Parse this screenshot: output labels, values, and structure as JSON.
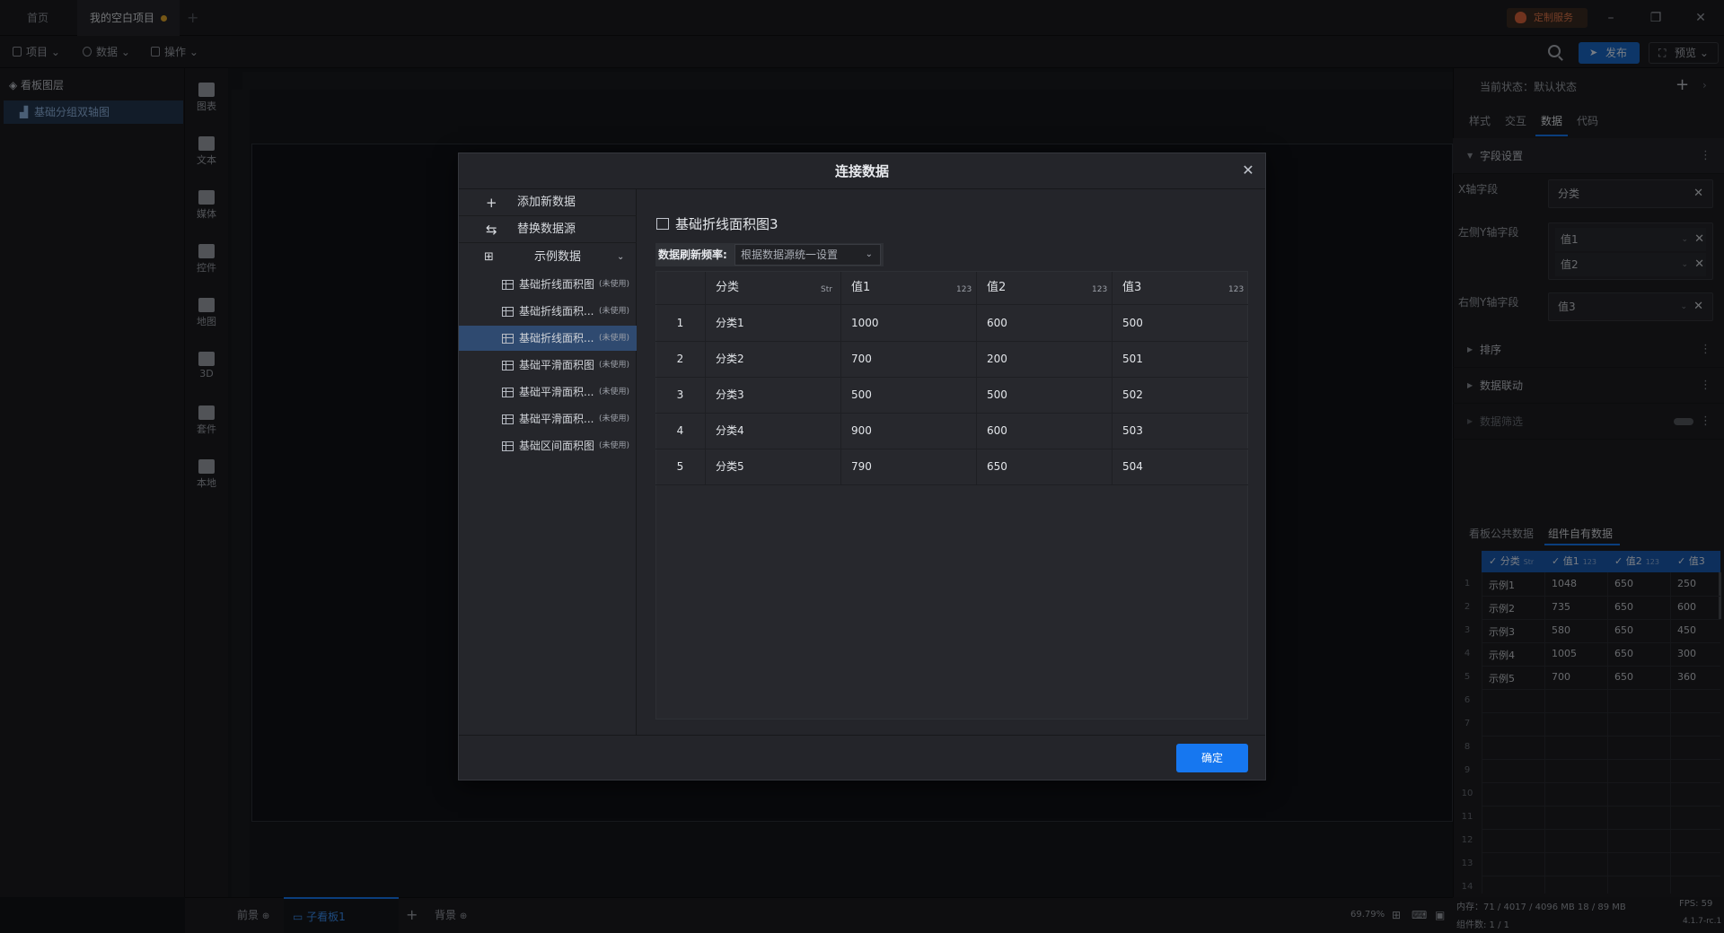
{
  "titlebar": {
    "tabs": [
      {
        "label": "首页"
      },
      {
        "label": "我的空白项目"
      }
    ],
    "custom_service": "定制服务"
  },
  "toolbar": {
    "menus": [
      {
        "label": "项目"
      },
      {
        "label": "数据"
      },
      {
        "label": "操作"
      }
    ],
    "publish": "发布",
    "preview": "预览"
  },
  "layers": {
    "header": "看板图层",
    "items": [
      {
        "label": "基础分组双轴图"
      }
    ]
  },
  "components": [
    {
      "label": "图表"
    },
    {
      "label": "文本"
    },
    {
      "label": "媒体"
    },
    {
      "label": "控件"
    },
    {
      "label": "地图"
    },
    {
      "label": "3D"
    },
    {
      "label": "套件"
    },
    {
      "label": "本地"
    }
  ],
  "right_panel": {
    "state_label": "当前状态：默认状态",
    "tabs": [
      {
        "label": "样式"
      },
      {
        "label": "交互"
      },
      {
        "label": "数据"
      },
      {
        "label": "代码"
      }
    ],
    "field_settings": "字段设置",
    "x_axis_label": "X轴字段",
    "x_axis_value": "分类",
    "left_y_label": "左侧Y轴字段",
    "left_y_values": [
      "值1",
      "值2"
    ],
    "right_y_label": "右侧Y轴字段",
    "right_y_value": "值3",
    "sections": [
      {
        "label": "排序"
      },
      {
        "label": "数据联动"
      },
      {
        "label": "数据筛选"
      }
    ],
    "data_tabs": [
      {
        "label": "看板公共数据"
      },
      {
        "label": "组件自有数据"
      }
    ],
    "table": {
      "columns": [
        "分类",
        "值1",
        "值2",
        "值3"
      ],
      "rows": [
        [
          "示例1",
          "1048",
          "650",
          "250"
        ],
        [
          "示例2",
          "735",
          "650",
          "600"
        ],
        [
          "示例3",
          "580",
          "650",
          "450"
        ],
        [
          "示例4",
          "1005",
          "650",
          "300"
        ],
        [
          "示例5",
          "700",
          "650",
          "360"
        ]
      ],
      "row_numbers": [
        "1",
        "2",
        "3",
        "4",
        "5",
        "6",
        "7",
        "8",
        "9",
        "10",
        "11",
        "12",
        "13",
        "14"
      ]
    }
  },
  "bottom": {
    "tabs": [
      {
        "label": "前景"
      },
      {
        "label": "子看板1"
      },
      {
        "label": "背景"
      }
    ],
    "zoom": "69.79%",
    "memory": "内存：71 / 4017 / 4096 MB  18 / 89 MB",
    "fps": "FPS: 59",
    "component_count": "组件数: 1 / 1",
    "version": "4.1.7-rc.1"
  },
  "modal": {
    "title": "连接数据",
    "add_data": "添加新数据",
    "replace_source": "替换数据源",
    "group": "示例数据",
    "sources": [
      {
        "label": "基础折线面积图",
        "tag": "(未使用)"
      },
      {
        "label": "基础折线面积...",
        "tag": "(未使用)"
      },
      {
        "label": "基础折线面积...",
        "tag": "(未使用)"
      },
      {
        "label": "基础平滑面积图",
        "tag": "(未使用)"
      },
      {
        "label": "基础平滑面积...",
        "tag": "(未使用)"
      },
      {
        "label": "基础平滑面积...",
        "tag": "(未使用)"
      },
      {
        "label": "基础区间面积图",
        "tag": "(未使用)"
      }
    ],
    "dataset_title": "基础折线面积图3",
    "refresh_label": "数据刷新频率:",
    "refresh_value": "根据数据源统一设置",
    "grid": {
      "columns": [
        {
          "label": "分类",
          "type": "Str"
        },
        {
          "label": "值1",
          "type": "123"
        },
        {
          "label": "值2",
          "type": "123"
        },
        {
          "label": "值3",
          "type": "123"
        }
      ],
      "rows": [
        [
          "1",
          "分类1",
          "1000",
          "600",
          "500"
        ],
        [
          "2",
          "分类2",
          "700",
          "200",
          "501"
        ],
        [
          "3",
          "分类3",
          "500",
          "500",
          "502"
        ],
        [
          "4",
          "分类4",
          "900",
          "600",
          "503"
        ],
        [
          "5",
          "分类5",
          "790",
          "650",
          "504"
        ]
      ]
    },
    "confirm": "确定"
  }
}
